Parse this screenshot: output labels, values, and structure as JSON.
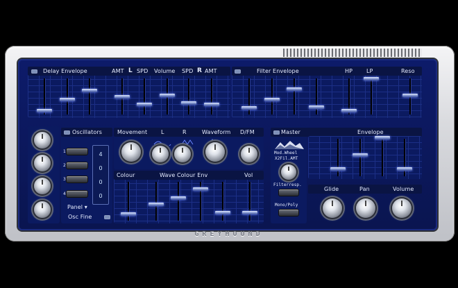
{
  "delay_section": {
    "title": "Delay Envelope",
    "labels": [
      "AMT",
      "L",
      "SPD",
      "Volume",
      "SPD",
      "R",
      "AMT"
    ]
  },
  "filter_section": {
    "title": "Filter Envelope",
    "labels": [
      "HP",
      "LP",
      "Reso"
    ]
  },
  "oscillators_section": {
    "title": "Oscillators",
    "labels": [
      "Movement",
      "L",
      "R",
      "Waveform",
      "D/FM"
    ],
    "osc_numbers": [
      "1",
      "2",
      "3",
      "4"
    ],
    "osc_values": [
      "4",
      "0",
      "0",
      "0"
    ]
  },
  "colour_section": {
    "labels": [
      "Colour",
      "Wave Colour Env",
      "Vol"
    ]
  },
  "master_section": {
    "title": "Master",
    "envelope_label": "Envelope",
    "mod_wheel_label": "Mod.Wheel",
    "mod_wheel_sub": "X2Fil.AMT",
    "filter_resp_label": "Filterresp.",
    "mono_poly_label": "Mono/Poly",
    "bottom_labels": [
      "Glide",
      "Pan",
      "Volume"
    ]
  },
  "left_panel": {
    "panel_label": "Panel ▾",
    "osc_fine_label": "Osc Fine"
  },
  "brand": "GREYHOUND",
  "colors": {
    "panel_blue": "#0d1b6a",
    "slider_glow": "#6a85ff",
    "frame_silver": "#d9dade"
  }
}
